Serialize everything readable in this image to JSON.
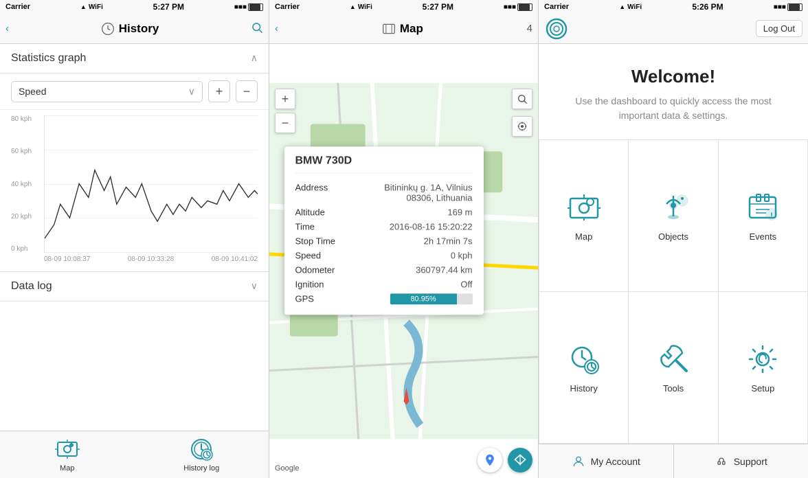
{
  "left_panel": {
    "status": {
      "carrier": "Carrier",
      "time": "5:27 PM",
      "battery": "■■■■"
    },
    "nav": {
      "back_label": "‹",
      "title": "History",
      "search_icon": "search"
    },
    "statistics_graph": {
      "title": "Statistics graph",
      "speed_label": "Speed",
      "y_labels": [
        "80 kph",
        "60 kph",
        "40 kph",
        "20 kph",
        "0 kph"
      ],
      "x_labels": [
        "08-09 10:08:37",
        "08-09 10:33:28",
        "08-09 10:41:02"
      ]
    },
    "data_log": {
      "title": "Data log"
    },
    "tabs": [
      {
        "label": "Map",
        "icon": "map-icon"
      },
      {
        "label": "History log",
        "icon": "history-icon"
      }
    ]
  },
  "middle_panel": {
    "status": {
      "carrier": "Carrier",
      "time": "5:27 PM",
      "battery": "■■■■"
    },
    "nav": {
      "back_label": "‹",
      "title": "Map",
      "badge": "4"
    },
    "popup": {
      "title": "BMW 730D",
      "rows": [
        {
          "label": "Address",
          "value": "Bitininkų g. 1A, Vilnius 08306, Lithuania"
        },
        {
          "label": "Altitude",
          "value": "169 m"
        },
        {
          "label": "Time",
          "value": "2016-08-16 15:20:22"
        },
        {
          "label": "Stop Time",
          "value": "2h 17min 7s"
        },
        {
          "label": "Speed",
          "value": "0 kph"
        },
        {
          "label": "Odometer",
          "value": "360797.44 km"
        },
        {
          "label": "Ignition",
          "value": "Off"
        },
        {
          "label": "GPS",
          "value": "80.95%",
          "bar": true,
          "bar_percent": 81
        }
      ]
    },
    "google_logo": "Google"
  },
  "right_panel": {
    "status": {
      "carrier": "Carrier",
      "time": "5:26 PM",
      "battery": "■■■■"
    },
    "nav": {
      "logout_label": "Log Out"
    },
    "welcome": {
      "title": "Welcome!",
      "subtitle": "Use the dashboard to quickly access the most important data & settings."
    },
    "grid_items": [
      {
        "label": "Map",
        "icon": "map-dash-icon"
      },
      {
        "label": "Objects",
        "icon": "objects-icon"
      },
      {
        "label": "Events",
        "icon": "events-icon"
      },
      {
        "label": "History",
        "icon": "history-dash-icon"
      },
      {
        "label": "Tools",
        "icon": "tools-icon"
      },
      {
        "label": "Setup",
        "icon": "setup-icon"
      }
    ],
    "bottom": {
      "account_label": "My Account",
      "support_label": "Support"
    }
  }
}
